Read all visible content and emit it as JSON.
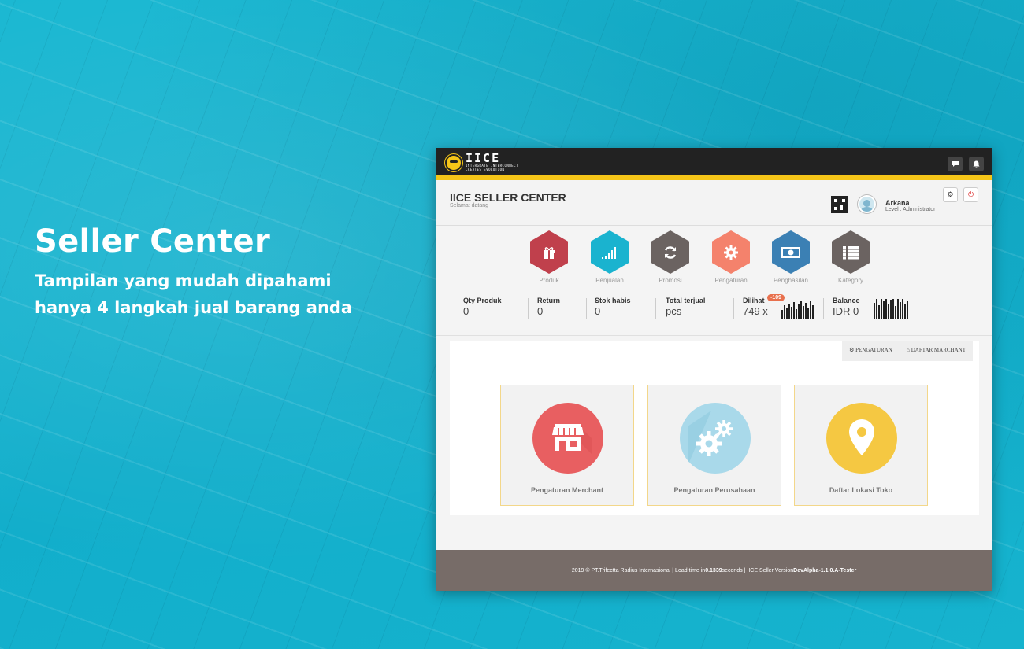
{
  "hero": {
    "title": "Seller Center",
    "line1": "Tampilan yang mudah dipahami",
    "line2": "hanya 4 langkah jual barang anda"
  },
  "app": {
    "logo_name": "IICE",
    "logo_tagline": "INTERGRATE INTERCONNECT\nCREATES EVOLUTION",
    "accent_color": "#f5c518"
  },
  "header": {
    "title": "IICE SELLER CENTER",
    "subtitle": "Selamat datang",
    "user_name": "Arkana",
    "user_level": "Level : Administrator"
  },
  "menu": [
    {
      "label": "Produk",
      "icon": "gift-icon",
      "color": "#c0404c"
    },
    {
      "label": "Penjualan",
      "icon": "signal-bars-icon",
      "color": "#1ab3cf"
    },
    {
      "label": "Promosi",
      "icon": "refresh-icon",
      "color": "#6b6361"
    },
    {
      "label": "Pengaturan",
      "icon": "gear-icon",
      "color": "#f4826c"
    },
    {
      "label": "Penghasilan",
      "icon": "money-icon",
      "color": "#3b80b4"
    },
    {
      "label": "Kategory",
      "icon": "list-icon",
      "color": "#6b6361"
    }
  ],
  "stats": {
    "qty_label": "Qty Produk",
    "qty_value": "0",
    "return_label": "Return",
    "return_value": "0",
    "stok_label": "Stok habis",
    "stok_value": "0",
    "terjual_label": "Total terjual",
    "terjual_value": "pcs",
    "dilihat_label": "Dilihat",
    "dilihat_value": "749 x",
    "dilihat_badge": "-109",
    "balance_label": "Balance",
    "balance_value": "IDR 0"
  },
  "panel": {
    "tab1": "PENGATURAN",
    "tab2": "DAFTAR MARCHANT",
    "cards": [
      {
        "label": "Pengaturan Merchant",
        "icon": "store-icon",
        "color": "#e85f61"
      },
      {
        "label": "Pengaturan Perusahaan",
        "icon": "gears-icon",
        "color": "#a9d9ea"
      },
      {
        "label": "Daftar Lokasi Toko",
        "icon": "location-pin-icon",
        "color": "#f5c842"
      }
    ]
  },
  "footer": {
    "text1": "2019 © PT.Trifectta Radius Internasional | Load time in ",
    "load_time": "0.1339",
    "text2": " seconds | IICE Seller Version ",
    "version": "DevAlpha-1.1.0.A-Tester"
  }
}
